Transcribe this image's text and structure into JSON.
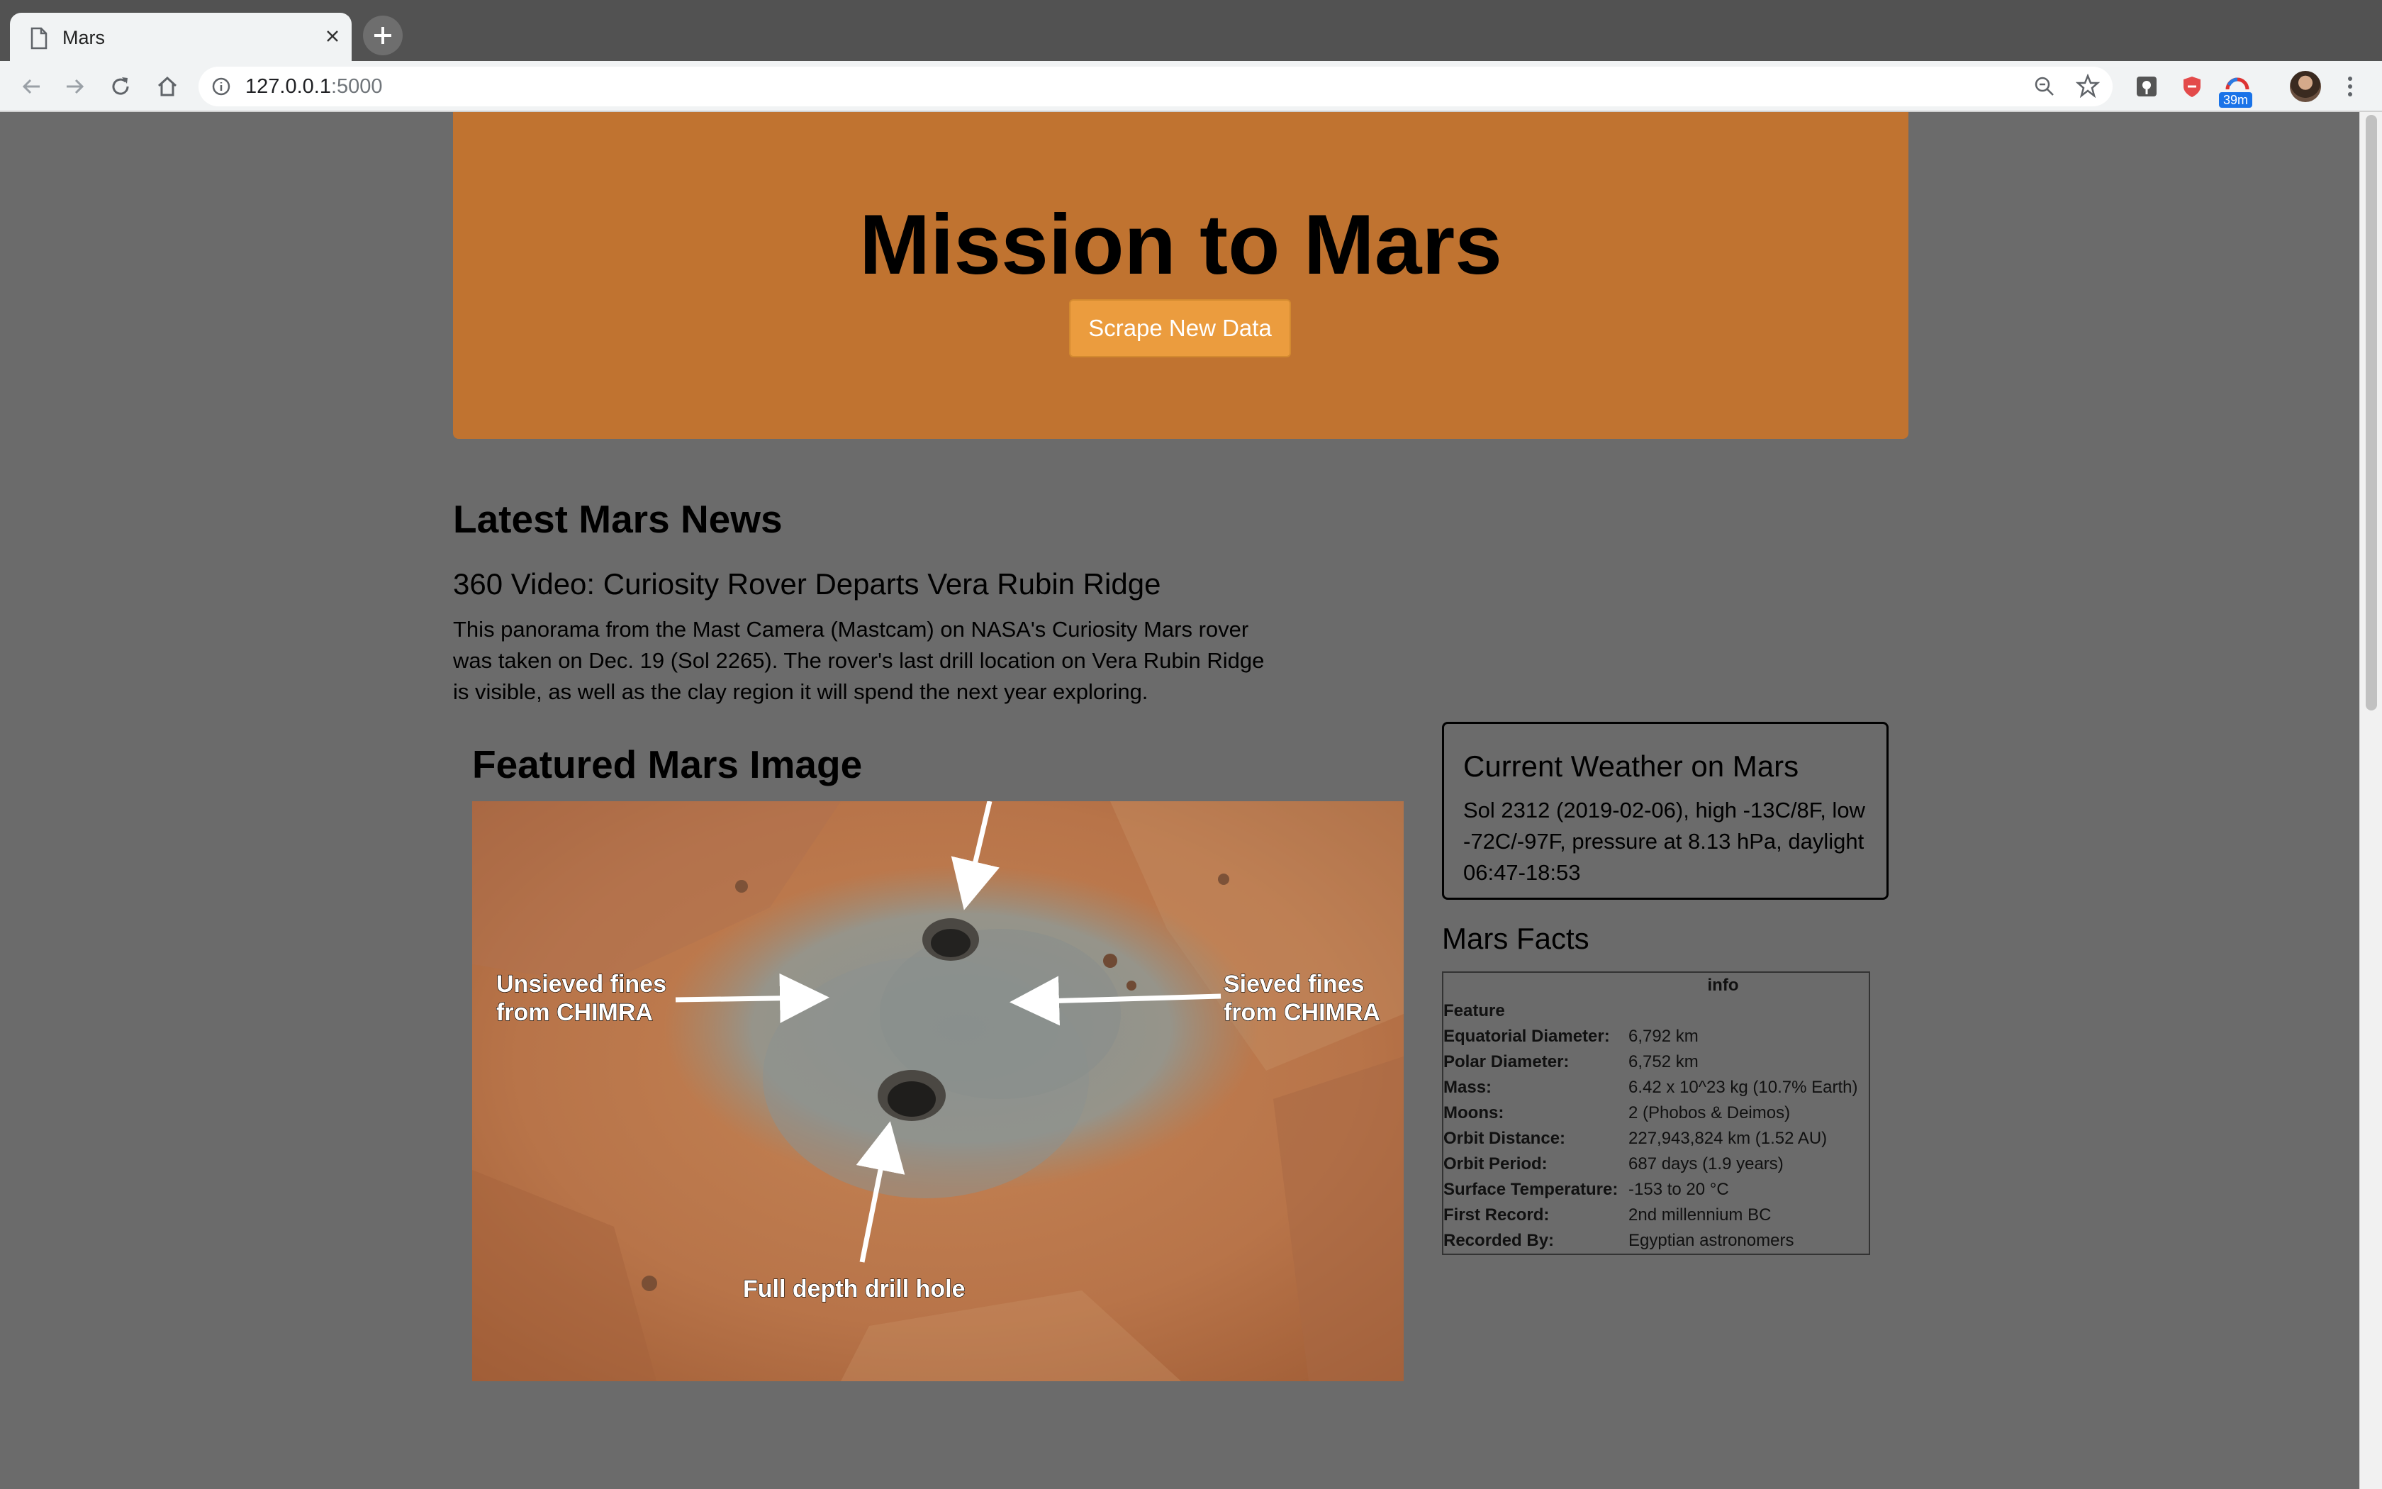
{
  "browser": {
    "tab_title": "Mars",
    "url_host": "127.0.0.1",
    "url_port": ":5000",
    "extension_badge": "39m"
  },
  "header": {
    "title": "Mission to Mars",
    "scrape_button": "Scrape New Data"
  },
  "news": {
    "heading": "Latest Mars News",
    "title": "360 Video: Curiosity Rover Departs Vera Rubin Ridge",
    "body": "This panorama from the Mast Camera (Mastcam) on NASA's Curiosity Mars rover was taken on Dec. 19 (Sol 2265). The rover's last drill location on Vera Rubin Ridge is visible, as well as the clay region it will spend the next year exploring."
  },
  "featured": {
    "heading": "Featured Mars Image",
    "labels": {
      "unsieved_line1": "Unsieved fines",
      "unsieved_line2": "from CHIMRA",
      "sieved_line1": "Sieved fines",
      "sieved_line2": "from CHIMRA",
      "drill_hole": "Full depth drill hole"
    }
  },
  "weather": {
    "heading": "Current Weather on Mars",
    "text": "Sol 2312 (2019-02-06), high -13C/8F, low -72C/-97F, pressure at 8.13 hPa, daylight 06:47-18:53"
  },
  "facts": {
    "heading": "Mars Facts",
    "col_header": "info",
    "index_header": "Feature",
    "rows": [
      {
        "label": "Equatorial Diameter:",
        "value": "6,792 km"
      },
      {
        "label": "Polar Diameter:",
        "value": "6,752 km"
      },
      {
        "label": "Mass:",
        "value": "6.42 x 10^23 kg (10.7% Earth)"
      },
      {
        "label": "Moons:",
        "value": "2 (Phobos & Deimos)"
      },
      {
        "label": "Orbit Distance:",
        "value": "227,943,824 km (1.52 AU)"
      },
      {
        "label": "Orbit Period:",
        "value": "687 days (1.9 years)"
      },
      {
        "label": "Surface Temperature:",
        "value": "-153 to 20 °C"
      },
      {
        "label": "First Record:",
        "value": "2nd millennium BC"
      },
      {
        "label": "Recorded By:",
        "value": "Egyptian astronomers"
      }
    ]
  },
  "colors": {
    "page_background": "#6b6b6b",
    "jumbotron": "#c07330",
    "button": "#eb9c3e"
  }
}
